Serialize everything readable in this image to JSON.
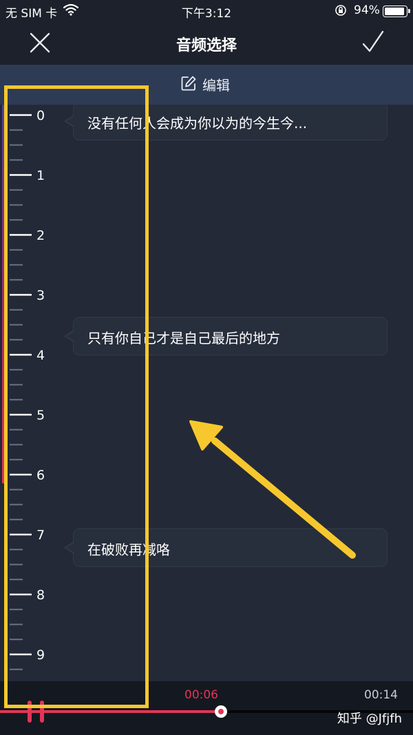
{
  "status_bar": {
    "carrier": "无 SIM 卡",
    "time": "下午3:12",
    "battery_percent": "94%",
    "battery_level": 0.94,
    "icons": [
      "wifi-icon",
      "rotation-lock-icon",
      "battery-icon"
    ]
  },
  "nav": {
    "title": "音频选择",
    "close_icon": "close-icon",
    "confirm_icon": "checkmark-icon"
  },
  "edit_bar": {
    "label": "编辑",
    "icon": "edit-icon"
  },
  "ruler": {
    "labels": [
      "0",
      "1",
      "2",
      "3",
      "4",
      "5",
      "6",
      "7",
      "8",
      "9"
    ],
    "minor_ticks_per_unit": 3
  },
  "lyrics": [
    {
      "text": "没有任何人会成为你以为的今生今..."
    },
    {
      "text": "只有你自己才是自己最后的地方"
    },
    {
      "text": "在破败再减咯"
    }
  ],
  "player": {
    "current_time": "00:06",
    "total_time": "00:14",
    "progress": 0.535,
    "pause_icon": "pause-icon"
  },
  "watermark": "知乎 @Jfjfh",
  "colors": {
    "accent": "#e23657",
    "highlight": "#f7c82d",
    "background": "#212733",
    "edit_bar": "#2e3b55"
  }
}
